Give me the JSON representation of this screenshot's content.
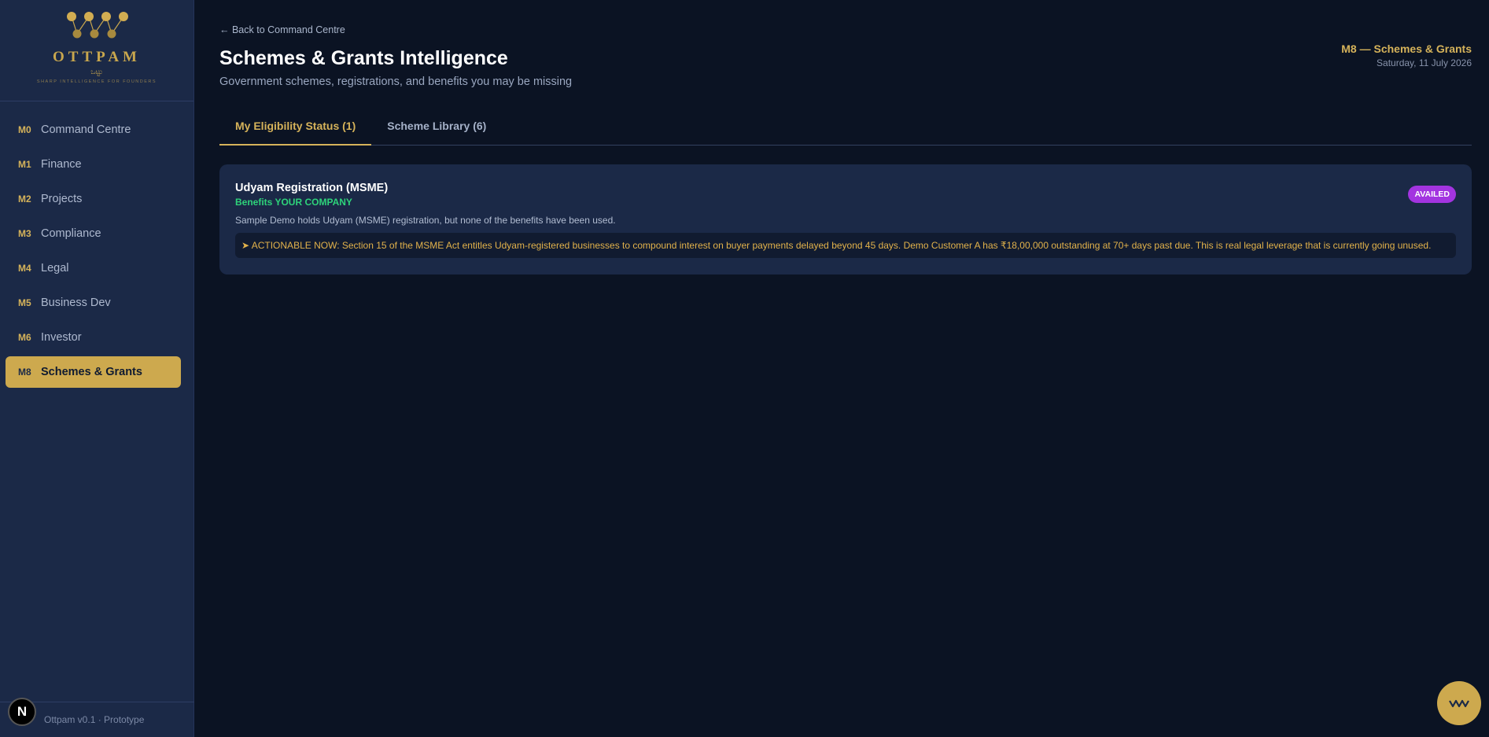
{
  "brand": {
    "name": "OTTPAM",
    "script_text": "ಒಟ್ಟು",
    "tagline": "SHARP INTELLIGENCE FOR FOUNDERS"
  },
  "nav": {
    "items": [
      {
        "code": "M0",
        "label": "Command Centre"
      },
      {
        "code": "M1",
        "label": "Finance"
      },
      {
        "code": "M2",
        "label": "Projects"
      },
      {
        "code": "M3",
        "label": "Compliance"
      },
      {
        "code": "M4",
        "label": "Legal"
      },
      {
        "code": "M5",
        "label": "Business Dev"
      },
      {
        "code": "M6",
        "label": "Investor"
      },
      {
        "code": "M8",
        "label": "Schemes & Grants"
      }
    ]
  },
  "footer": {
    "version": "Ottpam v0.1 · Prototype",
    "badge_letter": "N"
  },
  "header": {
    "back_link": "← Back to Command Centre",
    "title": "Schemes & Grants Intelligence",
    "subtitle": "Government schemes, registrations, and benefits you may be missing",
    "module_tag": "M8 — Schemes & Grants",
    "date": "Saturday, 11 July 2026"
  },
  "tabs": [
    {
      "label": "My Eligibility Status (1)"
    },
    {
      "label": "Scheme Library (6)"
    }
  ],
  "card": {
    "title": "Udyam Registration (MSME)",
    "benefit": "Benefits YOUR COMPANY",
    "description": "Sample Demo holds Udyam (MSME) registration, but none of the benefits have been used.",
    "status": "AVAILED",
    "action": "➤ ACTIONABLE NOW: Section 15 of the MSME Act entitles Udyam-registered businesses to compound interest on buyer payments delayed beyond 45 days. Demo Customer A has ₹18,00,000 outstanding at 70+ days past due. This is real legal leverage that is currently going unused."
  },
  "colors": {
    "accent": "#d6b35a",
    "sidebar_bg": "#1b2947",
    "page_bg": "#0b1323",
    "benefit_green": "#2ed37a",
    "badge_purple": "#a334e0",
    "action_text": "#e2b24b"
  }
}
